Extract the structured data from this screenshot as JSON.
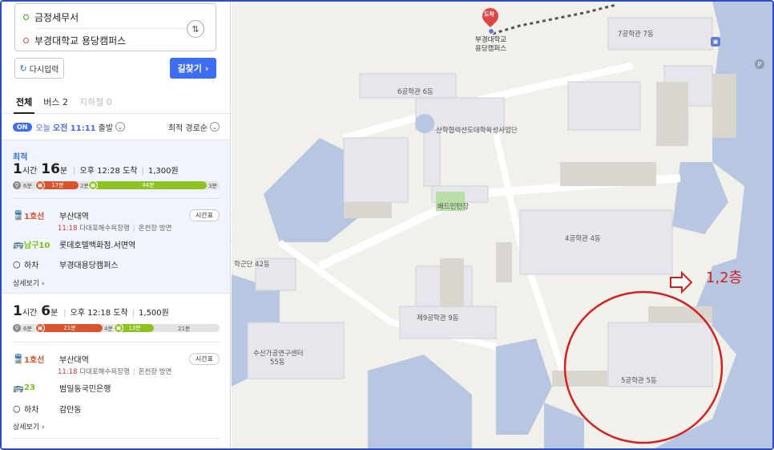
{
  "search": {
    "origin": "금정세무서",
    "destination": "부경대학교 용당캠퍼스",
    "swap_icon": "⇅",
    "reset_label": "다시입력",
    "find_label": "길찾기"
  },
  "tabs": [
    {
      "label": "전체"
    },
    {
      "label": "버스 2"
    },
    {
      "label": "지하철 0"
    }
  ],
  "depart": {
    "badge": "ON",
    "day": "오늘",
    "time": "오전 11:11",
    "suffix": "출발",
    "sort": "최적 경로순"
  },
  "routes": [
    {
      "tag": "최적",
      "hours": "1",
      "hours_unit": "시간",
      "minutes": "16",
      "minutes_unit": "분",
      "arrive": "오후 12:28 도착",
      "fare": "1,300원",
      "bar": {
        "walk1": "6분",
        "seg1": "17분",
        "walk2": "2분",
        "seg2": "44분",
        "walk3": "3분"
      },
      "steps": [
        {
          "line": "1호선",
          "stop": "부산대역",
          "color": "#d9532c"
        },
        {
          "line": "남구10",
          "stop": "롯데호텔백화점.서면역",
          "color": "#7cc110"
        },
        {
          "line": "하차",
          "stop": "부경대용당캠퍼스",
          "color": "#333333"
        }
      ],
      "sub": {
        "time": "11:18",
        "dir": "다대포해수욕장행",
        "door": "온천장 방면"
      },
      "timetable": "시간표",
      "more": "상세보기"
    },
    {
      "hours": "1",
      "hours_unit": "시간",
      "minutes": "6",
      "minutes_unit": "분",
      "arrive": "오후 12:18 도착",
      "fare": "1,500원",
      "bar": {
        "walk1": "6분",
        "seg1": "21분",
        "walk2": "4분",
        "seg2": "13분",
        "walk3": "21분"
      },
      "steps": [
        {
          "line": "1호선",
          "stop": "부산대역",
          "color": "#d9532c"
        },
        {
          "line": "23",
          "stop": "범일동국민은행",
          "color": "#7cc110"
        },
        {
          "line": "하차",
          "stop": "감만동",
          "color": "#333333"
        }
      ],
      "sub": {
        "time": "11:18",
        "dir": "다대포해수욕장행",
        "door": "온천장 방면"
      },
      "timetable": "시간표",
      "more": "상세보기"
    }
  ],
  "map": {
    "destination_badge": "도착",
    "destination_name_1": "부경대학교",
    "destination_name_2": "용당캠퍼스",
    "labels": {
      "b7": "7공학관 7동",
      "b6": "6공학관 6동",
      "incubator": "산학협력선도대학육성사업단",
      "badminton": "배드민턴장",
      "b4": "4공학관 4동",
      "b42": "학군단 42동",
      "b9": "제9공학관 9동",
      "b55a": "수산가공연구센터",
      "b55b": "55동",
      "b5": "5공학관 5동"
    },
    "annotation": "1,2층",
    "parking": "P"
  },
  "colors": {
    "accent": "#3d6df0",
    "subway": "#d9532c",
    "bus": "#7cc110",
    "annotation": "#d42020"
  }
}
